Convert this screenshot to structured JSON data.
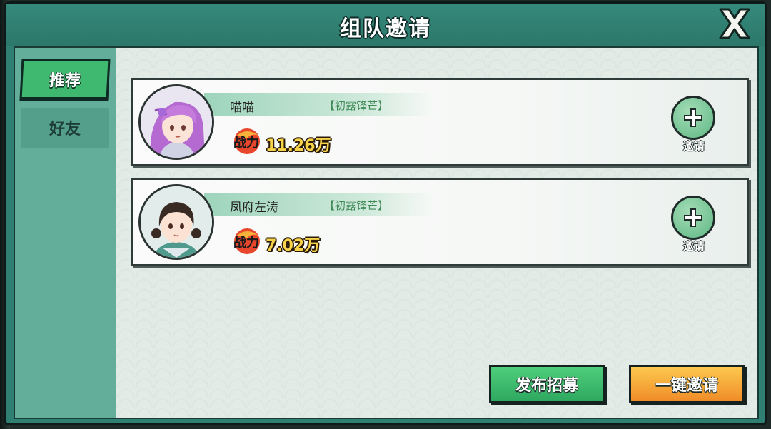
{
  "dialog": {
    "title": "组队邀请"
  },
  "tabs": [
    {
      "label": "推荐",
      "active": true
    },
    {
      "label": "好友",
      "active": false
    }
  ],
  "players": [
    {
      "name": "喵喵",
      "tag": "【初露锋芒】",
      "power": "11.26万",
      "invite_label": "邀请"
    },
    {
      "name": "凤府左涛",
      "tag": "【初露锋芒】",
      "power": "7.02万",
      "invite_label": "邀请"
    }
  ],
  "power_icon_text": "战力",
  "buttons": {
    "publish": "发布招募",
    "invite_all": "一键邀请"
  },
  "colors": {
    "panel_teal": "#2f7f72",
    "tab_active": "#3fb870",
    "publish_green": "#2ea860",
    "invite_all_orange": "#f08c28",
    "tag_green": "#3f8a55",
    "power_gold": "#f7d34a"
  }
}
